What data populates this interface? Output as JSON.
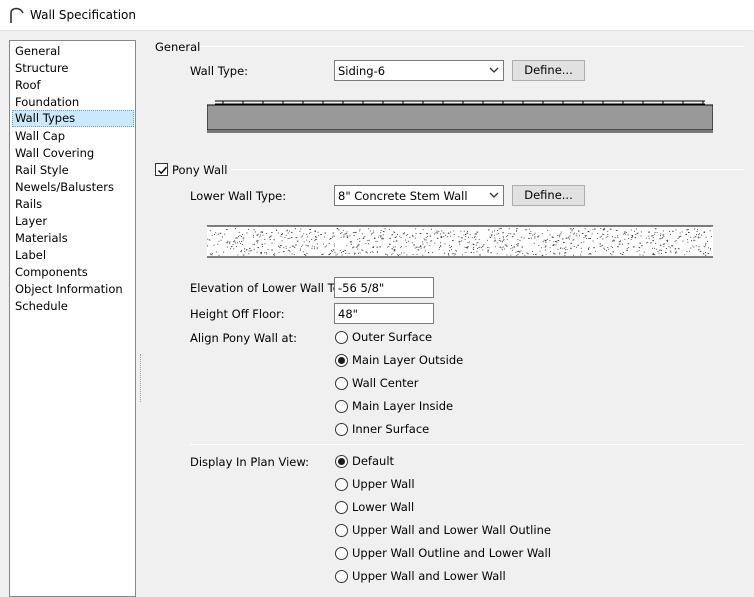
{
  "window": {
    "title": "Wall Specification",
    "icon": "arch-icon"
  },
  "nav": {
    "items": [
      {
        "label": "General"
      },
      {
        "label": "Structure"
      },
      {
        "label": "Roof"
      },
      {
        "label": "Foundation"
      },
      {
        "label": "Wall Types",
        "selected": true
      },
      {
        "label": "Wall Cap"
      },
      {
        "label": "Wall Covering"
      },
      {
        "label": "Rail Style"
      },
      {
        "label": "Newels/Balusters"
      },
      {
        "label": "Rails"
      },
      {
        "label": "Layer"
      },
      {
        "label": "Materials"
      },
      {
        "label": "Label"
      },
      {
        "label": "Components"
      },
      {
        "label": "Object Information"
      },
      {
        "label": "Schedule"
      }
    ]
  },
  "general": {
    "title": "General",
    "wall_type_label": "Wall Type:",
    "wall_type_value": "Siding-6",
    "define_label": "Define..."
  },
  "pony": {
    "checkbox_label": "Pony Wall",
    "checked": true,
    "lower_wall_type_label": "Lower Wall Type:",
    "lower_wall_type_value": "8\" Concrete Stem Wall",
    "define_label": "Define...",
    "elevation_label": "Elevation of Lower Wall Top:",
    "elevation_value": "-56 5/8\"",
    "height_label": "Height Off Floor:",
    "height_value": "48\"",
    "align_label": "Align Pony Wall at:",
    "align_options": [
      {
        "label": "Outer Surface",
        "selected": false
      },
      {
        "label": "Main Layer Outside",
        "selected": true
      },
      {
        "label": "Wall Center",
        "selected": false
      },
      {
        "label": "Main Layer Inside",
        "selected": false
      },
      {
        "label": "Inner Surface",
        "selected": false
      }
    ]
  },
  "display": {
    "label": "Display In Plan View:",
    "options": [
      {
        "label": "Default",
        "selected": true
      },
      {
        "label": "Upper Wall",
        "selected": false
      },
      {
        "label": "Lower Wall",
        "selected": false
      },
      {
        "label": "Upper Wall and Lower Wall Outline",
        "selected": false
      },
      {
        "label": "Upper Wall Outline and Lower Wall",
        "selected": false
      },
      {
        "label": "Upper Wall and Lower Wall",
        "selected": false
      }
    ]
  }
}
